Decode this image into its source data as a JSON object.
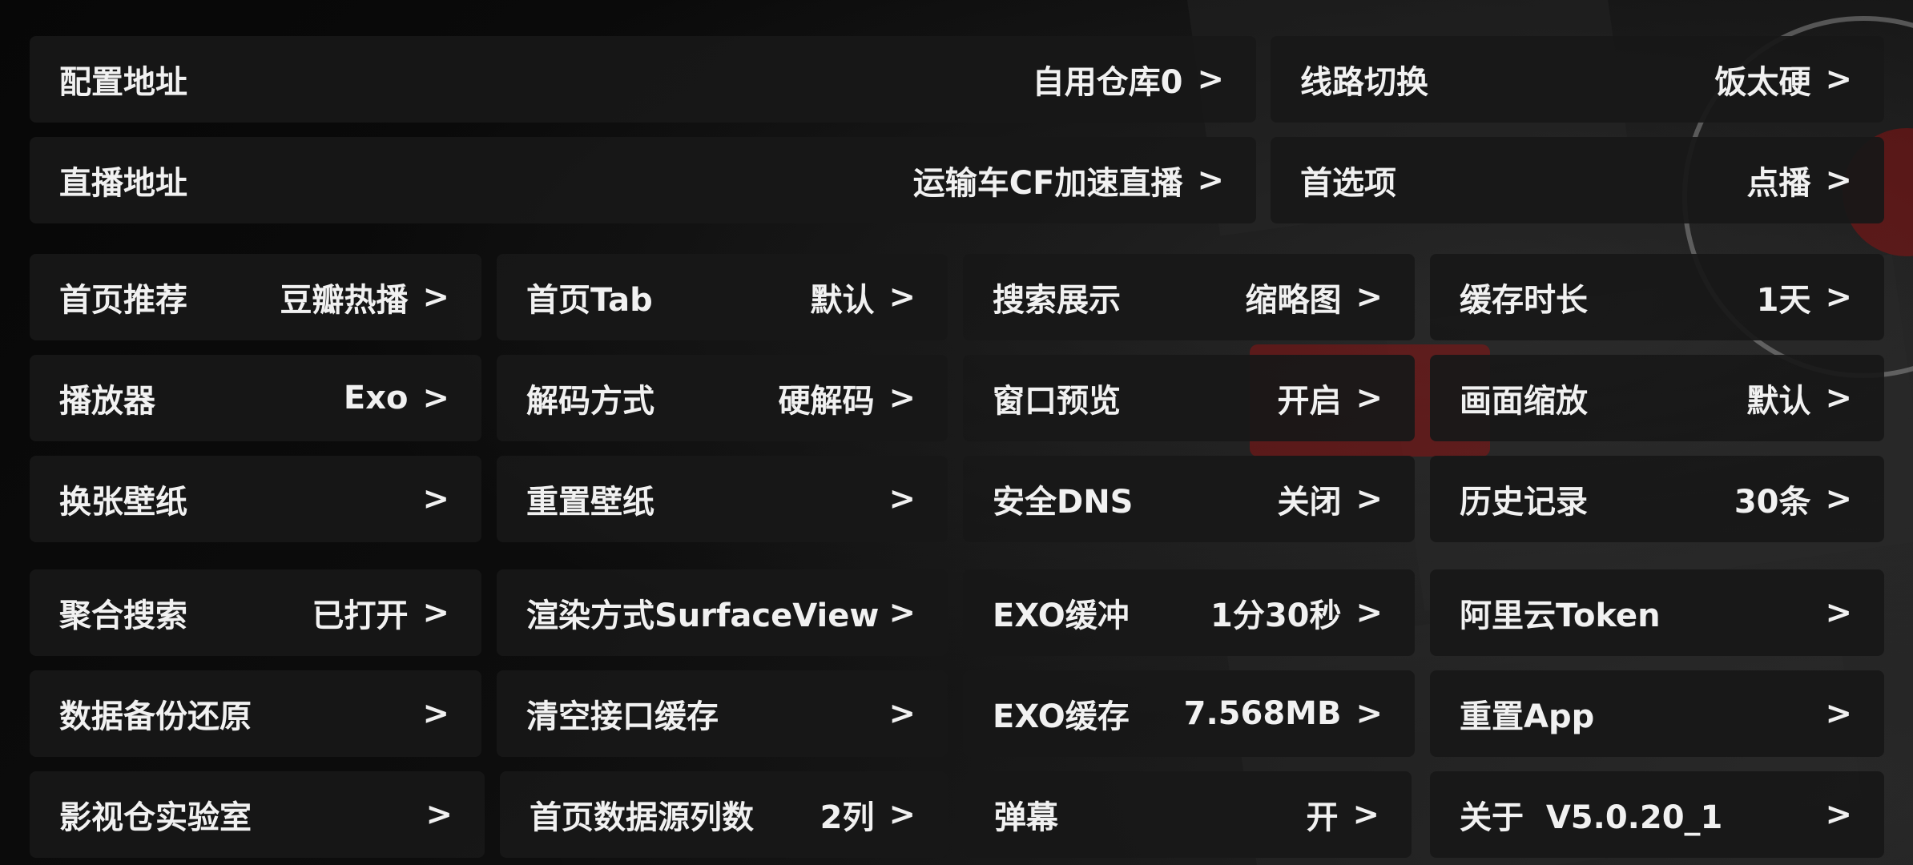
{
  "rows": [
    [
      {
        "label": "配置地址",
        "value": "自用仓库0"
      },
      {
        "label": "线路切换",
        "value": "饭太硬"
      }
    ],
    [
      {
        "label": "直播地址",
        "value": "运输车CF加速直播"
      },
      {
        "label": "首选项",
        "value": "点播"
      }
    ],
    [
      {
        "label": "首页推荐",
        "value": "豆瓣热播"
      },
      {
        "label": "首页Tab",
        "value": "默认"
      },
      {
        "label": "搜索展示",
        "value": "缩略图"
      },
      {
        "label": "缓存时长",
        "value": "1天"
      }
    ],
    [
      {
        "label": "播放器",
        "value": "Exo"
      },
      {
        "label": "解码方式",
        "value": "硬解码"
      },
      {
        "label": "窗口预览",
        "value": "开启"
      },
      {
        "label": "画面缩放",
        "value": "默认"
      }
    ],
    [
      {
        "label": "换张壁纸",
        "value": ""
      },
      {
        "label": "重置壁纸",
        "value": ""
      },
      {
        "label": "安全DNS",
        "value": "关闭"
      },
      {
        "label": "历史记录",
        "value": "30条"
      }
    ],
    [
      {
        "label": "聚合搜索",
        "value": "已打开"
      },
      {
        "label": "渲染方式SurfaceView",
        "value": ""
      },
      {
        "label": "EXO缓冲",
        "value": "1分30秒"
      },
      {
        "label": "阿里云Token",
        "value": ""
      }
    ],
    [
      {
        "label": "数据备份还原",
        "value": ""
      },
      {
        "label": "清空接口缓存",
        "value": ""
      },
      {
        "label": "EXO缓存",
        "value": "7.568MB"
      },
      {
        "label": "重置App",
        "value": ""
      }
    ],
    [
      {
        "label": "影视仓实验室",
        "value": ""
      },
      {
        "label": "首页数据源列数",
        "value": "2列"
      },
      {
        "label": "弹幕",
        "value": "开"
      },
      {
        "label": "关于  V5.0.20_1",
        "value": ""
      }
    ]
  ],
  "arrow_glyph": ">"
}
